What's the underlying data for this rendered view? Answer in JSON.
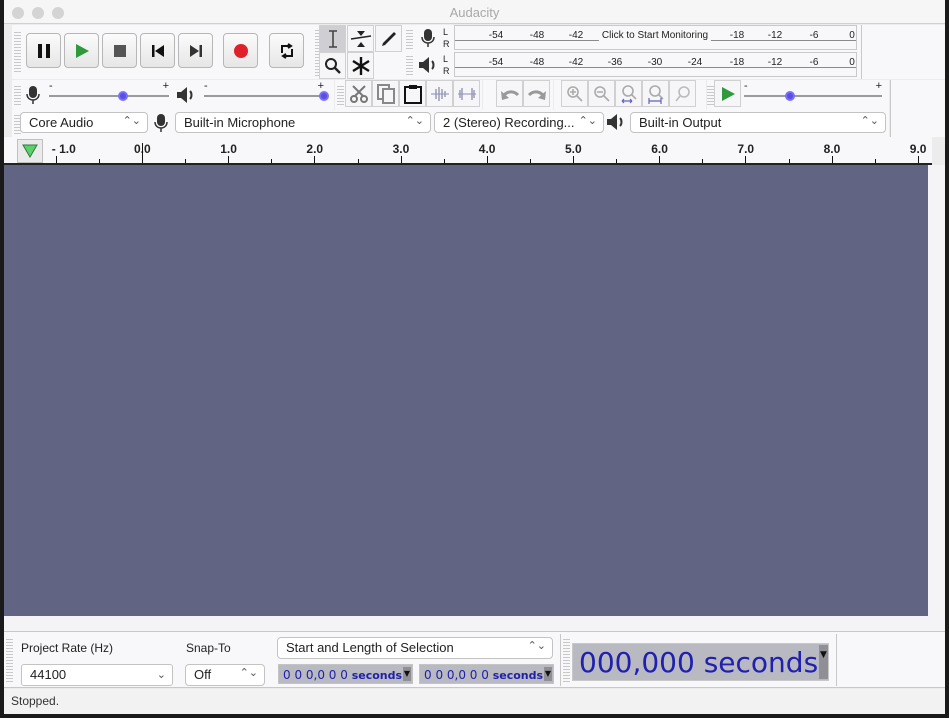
{
  "window": {
    "title": "Audacity"
  },
  "transport": {
    "buttons": [
      {
        "name": "pause-button",
        "icon": "pause-icon"
      },
      {
        "name": "play-button",
        "icon": "play-icon"
      },
      {
        "name": "stop-button",
        "icon": "stop-icon"
      },
      {
        "name": "skip-to-start-button",
        "icon": "skip-start-icon"
      },
      {
        "name": "skip-to-end-button",
        "icon": "skip-end-icon"
      },
      {
        "name": "record-button",
        "icon": "record-icon"
      },
      {
        "name": "loop-button",
        "icon": "loop-icon"
      }
    ]
  },
  "tools": {
    "items": [
      "selection-tool",
      "envelope-tool",
      "draw-tool",
      "zoom-tool",
      "multi-tool"
    ],
    "active": "selection-tool"
  },
  "meters": {
    "record": {
      "channels": [
        "L",
        "R"
      ],
      "ticks": [
        "-54",
        "-48",
        "-42",
        "-18",
        "-12",
        "-6",
        "0"
      ],
      "label": "Click to Start Monitoring"
    },
    "playback": {
      "channels": [
        "L",
        "R"
      ],
      "ticks": [
        "-54",
        "-48",
        "-42",
        "-36",
        "-30",
        "-24",
        "-18",
        "-12",
        "-6",
        "0"
      ]
    }
  },
  "mixer": {
    "record_volume": {
      "min": "-",
      "max": "+",
      "value": 0.62
    },
    "playback_volume": {
      "min": "-",
      "max": "+",
      "value": 1.0
    }
  },
  "play_at_speed": {
    "min": "-",
    "max": "+",
    "value": 0.33
  },
  "devices": {
    "host": "Core Audio",
    "input": "Built-in Microphone",
    "channels": "2 (Stereo) Recording...",
    "output": "Built-in Output"
  },
  "ruler": {
    "labels": [
      "- 1.0",
      "0.0",
      "1.0",
      "2.0",
      "3.0",
      "4.0",
      "5.0",
      "6.0",
      "7.0",
      "8.0",
      "9.0"
    ]
  },
  "selection_toolbar": {
    "project_rate_label": "Project Rate (Hz)",
    "project_rate": "44100",
    "snap_to_label": "Snap-To",
    "snap_to": "Off",
    "selection_mode": "Start and Length of Selection",
    "start_time": "0 0 0,0 0 0",
    "start_unit": "seconds",
    "length_time": "0 0 0,0 0 0",
    "length_unit": "seconds"
  },
  "time_toolbar": {
    "time": "000,000",
    "unit": "seconds"
  },
  "status": {
    "text": "Stopped."
  }
}
